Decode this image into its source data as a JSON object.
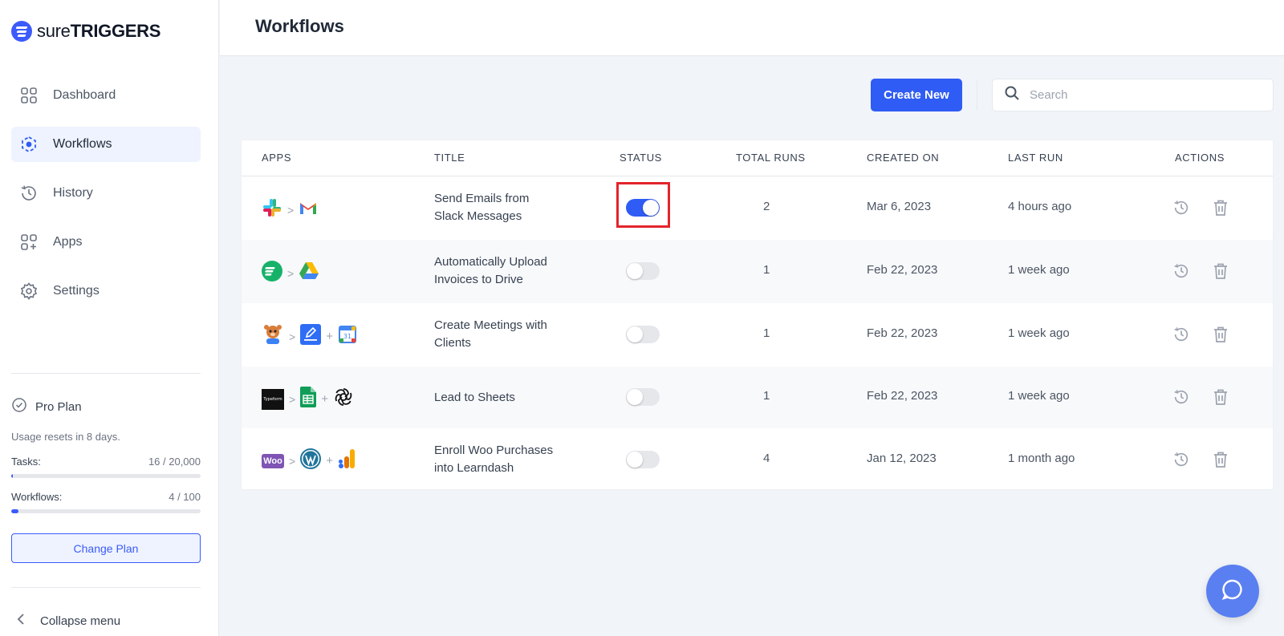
{
  "brand": {
    "name_light": "sure",
    "name_bold": "TRIGGERS"
  },
  "header": {
    "title": "Workflows"
  },
  "sidebar": {
    "items": [
      {
        "label": "Dashboard",
        "icon": "grid-icon",
        "active": false
      },
      {
        "label": "Workflows",
        "icon": "workflow-icon",
        "active": true
      },
      {
        "label": "History",
        "icon": "history-icon",
        "active": false
      },
      {
        "label": "Apps",
        "icon": "apps-add-icon",
        "active": false
      },
      {
        "label": "Settings",
        "icon": "gear-icon",
        "active": false
      }
    ],
    "plan": {
      "name": "Pro Plan",
      "note": "Usage resets in 8 days.",
      "tasks_label": "Tasks:",
      "tasks_value": "16 / 20,000",
      "tasks_fraction": 0.0008,
      "workflows_label": "Workflows:",
      "workflows_value": "4 / 100",
      "workflows_fraction": 0.04,
      "change_plan_label": "Change Plan"
    },
    "collapse_label": "Collapse menu"
  },
  "toolbar": {
    "create_label": "Create New",
    "search_placeholder": "Search"
  },
  "table": {
    "columns": [
      "APPS",
      "TITLE",
      "STATUS",
      "TOTAL RUNS",
      "CREATED ON",
      "LAST RUN",
      "ACTIONS"
    ],
    "rows": [
      {
        "apps": [
          "slack-icon",
          "gmail-icon"
        ],
        "title": "Send Emails from Slack Messages",
        "title_lines": [
          "Send Emails from",
          "Slack Messages"
        ],
        "status_on": true,
        "total_runs": "2",
        "created_on": "Mar 6, 2023",
        "last_run": "4 hours ago"
      },
      {
        "apps": [
          "suretriggers-icon",
          "google-drive-icon"
        ],
        "title": "Automatically Upload Invoices to Drive",
        "title_lines": [
          "Automatically Upload",
          "Invoices to Drive"
        ],
        "status_on": false,
        "total_runs": "1",
        "created_on": "Feb 22, 2023",
        "last_run": "1 week ago"
      },
      {
        "apps": [
          "forms-mascot-icon",
          "edit-form-icon",
          "google-calendar-icon"
        ],
        "title": "Create Meetings with Clients",
        "title_lines": [
          "Create Meetings with",
          "Clients"
        ],
        "status_on": false,
        "total_runs": "1",
        "created_on": "Feb 22, 2023",
        "last_run": "1 week ago"
      },
      {
        "apps": [
          "typeform-icon",
          "google-sheets-icon",
          "openai-icon"
        ],
        "title": "Lead to Sheets",
        "title_lines": [
          "Lead to Sheets"
        ],
        "status_on": false,
        "total_runs": "1",
        "created_on": "Feb 22, 2023",
        "last_run": "1 week ago"
      },
      {
        "apps": [
          "woocommerce-icon",
          "wordpress-icon",
          "analytics-icon"
        ],
        "title": "Enroll Woo Purchases into Learndash",
        "title_lines": [
          "Enroll Woo Purchases",
          "into Learndash"
        ],
        "status_on": false,
        "total_runs": "4",
        "created_on": "Jan 12, 2023",
        "last_run": "1 month ago"
      }
    ],
    "typeform_text": "Typeform",
    "woo_text": "Woo"
  },
  "colors": {
    "accent": "#2f5cf4",
    "highlight": "#e3242b",
    "chat": "#5a7ff0"
  }
}
